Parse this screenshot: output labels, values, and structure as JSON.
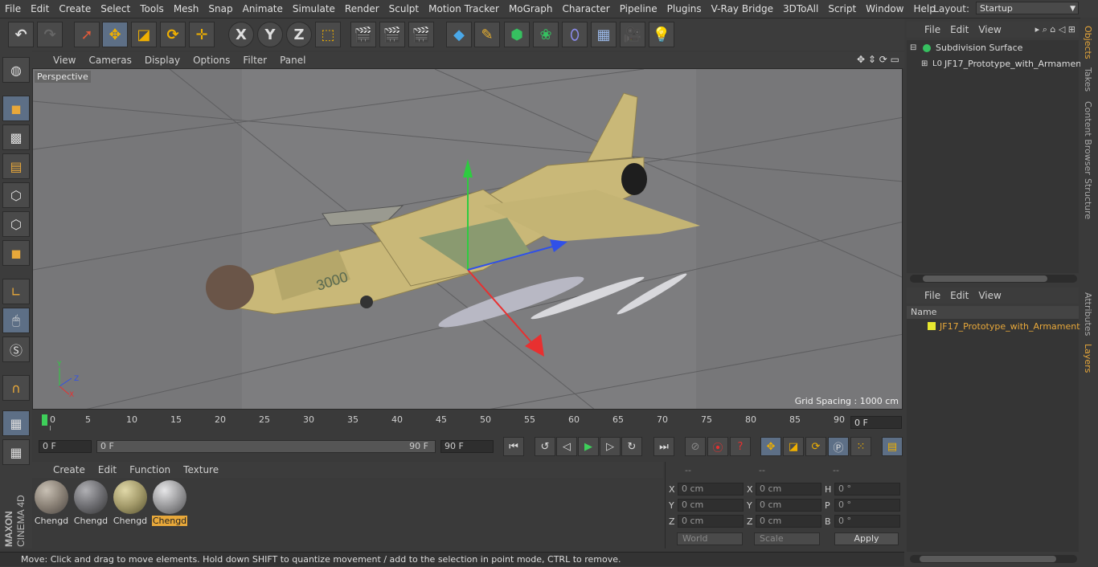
{
  "menu": [
    "File",
    "Edit",
    "Create",
    "Select",
    "Tools",
    "Mesh",
    "Snap",
    "Animate",
    "Simulate",
    "Render",
    "Sculpt",
    "Motion Tracker",
    "MoGraph",
    "Character",
    "Pipeline",
    "Plugins",
    "V-Ray Bridge",
    "3DToAll",
    "Script",
    "Window",
    "Help"
  ],
  "layout": {
    "label": "Layout:",
    "value": "Startup"
  },
  "toolbar": {
    "x": "X",
    "y": "Y",
    "z": "Z"
  },
  "viewport": {
    "menu": [
      "View",
      "Cameras",
      "Display",
      "Options",
      "Filter",
      "Panel"
    ],
    "label": "Perspective",
    "grid_spacing": "Grid Spacing : 1000 cm",
    "model_number": "3000",
    "axis": {
      "x": "X",
      "y": "Y",
      "z": "Z"
    }
  },
  "timeline": {
    "ticks": [
      "0",
      "5",
      "10",
      "15",
      "20",
      "25",
      "30",
      "35",
      "40",
      "45",
      "50",
      "55",
      "60",
      "65",
      "70",
      "75",
      "80",
      "85",
      "90"
    ],
    "current_frame": "0 F",
    "start_field": "0 F",
    "range_start": "0 F",
    "range_end": "90 F",
    "end_field": "90 F"
  },
  "materials": {
    "menu": [
      "Create",
      "Edit",
      "Function",
      "Texture"
    ],
    "items": [
      {
        "name": "Chengd",
        "color": "#8a8176",
        "selected": false
      },
      {
        "name": "Chengd",
        "color": "#6e6e72",
        "selected": false
      },
      {
        "name": "Chengd",
        "color": "#a39a6a",
        "selected": false
      },
      {
        "name": "Chengd",
        "color": "#9a9a9c",
        "selected": true
      }
    ]
  },
  "coordinates": {
    "headers": [
      "--",
      "--",
      "--"
    ],
    "rows": [
      {
        "a": "X",
        "av": "0 cm",
        "b": "X",
        "bv": "0 cm",
        "c": "H",
        "cv": "0 °"
      },
      {
        "a": "Y",
        "av": "0 cm",
        "b": "Y",
        "bv": "0 cm",
        "c": "P",
        "cv": "0 °"
      },
      {
        "a": "Z",
        "av": "0 cm",
        "b": "Z",
        "bv": "0 cm",
        "c": "B",
        "cv": "0 °"
      }
    ],
    "space": "World",
    "mode": "Scale",
    "apply": "Apply"
  },
  "status": "Move: Click and drag to move elements. Hold down SHIFT to quantize movement / add to the selection in point mode, CTRL to remove.",
  "object_manager": {
    "menu": [
      "File",
      "Edit",
      "View"
    ],
    "items": [
      "Subdivision Surface",
      "JF17_Prototype_with_Armament"
    ]
  },
  "layer_manager": {
    "menu": [
      "File",
      "Edit",
      "View"
    ],
    "header": "Name",
    "items": [
      "JF17_Prototype_with_Armament"
    ]
  },
  "side_tabs": [
    "Objects",
    "Takes",
    "Content Browser",
    "Structure",
    "Attributes",
    "Layers"
  ],
  "brand": {
    "maxon": "MAXON",
    "product": "CINEMA 4D"
  },
  "colors": {
    "accent": "#e8a83a",
    "active_tool": "#5d6f86",
    "viewport_bg": "#777779"
  }
}
